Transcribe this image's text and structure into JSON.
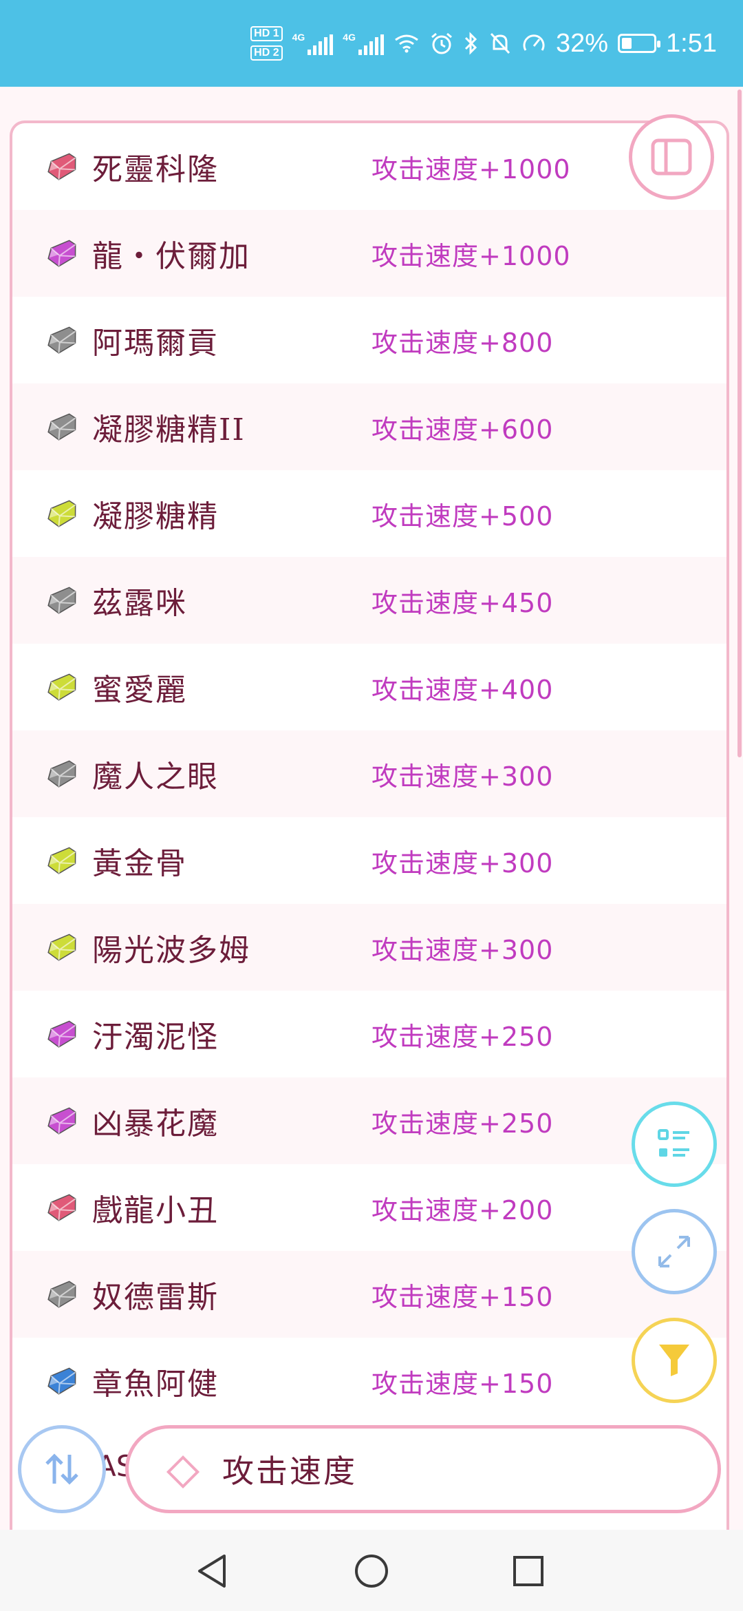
{
  "status_bar": {
    "hd1": "HD 1",
    "hd2": "HD 2",
    "net1": "4G",
    "net2": "4G",
    "battery_text": "32%",
    "battery_level": 0.32,
    "time": "1:51"
  },
  "items": [
    {
      "name": "死靈科隆",
      "stat": "攻击速度+1000",
      "gem_color": "#e05a78"
    },
    {
      "name": "龍・伏爾加",
      "stat": "攻击速度+1000",
      "gem_color": "#c74fd0"
    },
    {
      "name": "阿瑪爾貢",
      "stat": "攻击速度+800",
      "gem_color": "#8e8e8e"
    },
    {
      "name": "凝膠糖精II",
      "stat": "攻击速度+600",
      "gem_color": "#8e8e8e"
    },
    {
      "name": "凝膠糖精",
      "stat": "攻击速度+500",
      "gem_color": "#cddc39"
    },
    {
      "name": "茲露咪",
      "stat": "攻击速度+450",
      "gem_color": "#8e8e8e"
    },
    {
      "name": "蜜愛麗",
      "stat": "攻击速度+400",
      "gem_color": "#cddc39"
    },
    {
      "name": "魔人之眼",
      "stat": "攻击速度+300",
      "gem_color": "#8e8e8e"
    },
    {
      "name": "黃金骨",
      "stat": "攻击速度+300",
      "gem_color": "#cddc39"
    },
    {
      "name": "陽光波多姆",
      "stat": "攻击速度+300",
      "gem_color": "#cddc39"
    },
    {
      "name": "汙濁泥怪",
      "stat": "攻击速度+250",
      "gem_color": "#c74fd0"
    },
    {
      "name": "凶暴花魔",
      "stat": "攻击速度+250",
      "gem_color": "#c74fd0"
    },
    {
      "name": "戲龍小丑",
      "stat": "攻击速度+200",
      "gem_color": "#e05a78"
    },
    {
      "name": "奴德雷斯",
      "stat": "攻击速度+150",
      "gem_color": "#8e8e8e"
    },
    {
      "name": "章魚阿健",
      "stat": "攻击速度+150",
      "gem_color": "#3b82d6"
    }
  ],
  "partial_row_text": "AS",
  "search": {
    "value": "攻击速度"
  },
  "colors": {
    "status_bar": "#4dc1e6",
    "accent_pink": "#f2a7c1",
    "name_text": "#6c1d3a",
    "stat_text": "#c03bbf"
  }
}
